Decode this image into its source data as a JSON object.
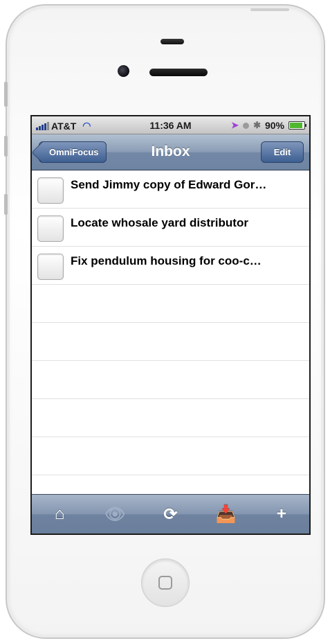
{
  "status": {
    "carrier": "AT&T",
    "time": "11:36 AM",
    "battery": "90%",
    "battery_level": 0.9
  },
  "nav": {
    "back_label": "OmniFocus",
    "title": "Inbox",
    "edit_label": "Edit"
  },
  "tasks": [
    {
      "title": "Send Jimmy copy of Edward Gor…",
      "completed": false
    },
    {
      "title": "Locate whosale yard distributor",
      "completed": false
    },
    {
      "title": "Fix pendulum housing for coo-c…",
      "completed": false
    }
  ],
  "empty_rows": 6,
  "toolbar": {
    "items": [
      {
        "icon": "home-icon",
        "glyph": "⌂",
        "enabled": true
      },
      {
        "icon": "perspective-eye-icon",
        "glyph": "👁",
        "enabled": false
      },
      {
        "icon": "sync-icon",
        "glyph": "⟳",
        "enabled": true
      },
      {
        "icon": "inbox-tray-icon",
        "glyph": "📥",
        "enabled": true
      },
      {
        "icon": "add-icon",
        "glyph": "+",
        "enabled": true
      }
    ]
  },
  "colors": {
    "nav_bar": "#7a8fab",
    "button": "#4a6a9c",
    "battery_fill": "#4fb82e",
    "location_arrow": "#a040d8"
  }
}
